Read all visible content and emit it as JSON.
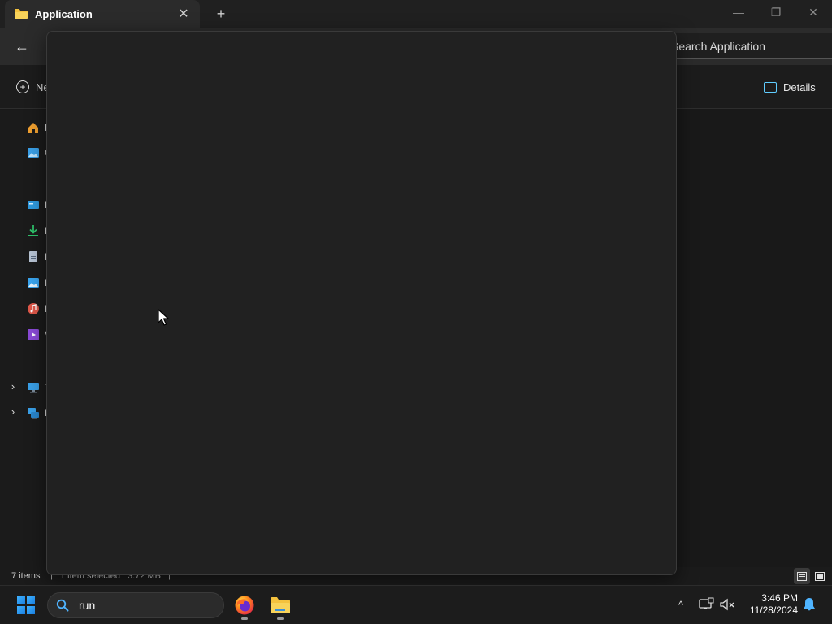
{
  "window": {
    "tab_title": "Application",
    "tab_close_glyph": "✕",
    "new_tab_glyph": "+",
    "controls": {
      "minimize_glyph": "—",
      "maximize_glyph": "❐",
      "close_glyph": "✕"
    }
  },
  "navbar": {
    "back_glyph": "←",
    "search_text": "Search Application"
  },
  "commandbar": {
    "new_label": "New",
    "details_label": "Details"
  },
  "sidebar": {
    "items": [
      {
        "name": "home",
        "label": "H",
        "icon": "home-icon",
        "color": "#f0a030"
      },
      {
        "name": "gallery",
        "label": "G",
        "icon": "gallery-icon",
        "color": "#3aa0e8"
      },
      {
        "name": "desktop",
        "label": "D",
        "icon": "desktop-icon",
        "color": "#2f9be0"
      },
      {
        "name": "downloads",
        "label": "D",
        "icon": "download-icon",
        "color": "#2fc46c"
      },
      {
        "name": "documents",
        "label": "D",
        "icon": "documents-icon",
        "color": "#b8c4d4"
      },
      {
        "name": "pictures",
        "label": "P",
        "icon": "pictures-icon",
        "color": "#3aa6f0"
      },
      {
        "name": "music",
        "label": "M",
        "icon": "music-icon",
        "color": "#e0584a"
      },
      {
        "name": "videos",
        "label": "V",
        "icon": "videos-icon",
        "color": "#8a4ad6"
      },
      {
        "name": "this-pc",
        "label": "T",
        "icon": "computer-icon",
        "color": "#3aa0e8"
      },
      {
        "name": "network",
        "label": "N",
        "icon": "network-icon",
        "color": "#3aa0e8"
      }
    ],
    "chevron_glyph": "›"
  },
  "statusbar": {
    "item_count": "7 items",
    "selected": "1 item selected",
    "size": "3.72 MB",
    "separator": "|"
  },
  "taskbar": {
    "search_value": "run",
    "tray_chevron_glyph": "^",
    "time": "3:46 PM",
    "date": "11/28/2024"
  },
  "colors": {
    "accent": "#60cdff",
    "popup_bg": "#212121",
    "window_bg": "#191919"
  }
}
